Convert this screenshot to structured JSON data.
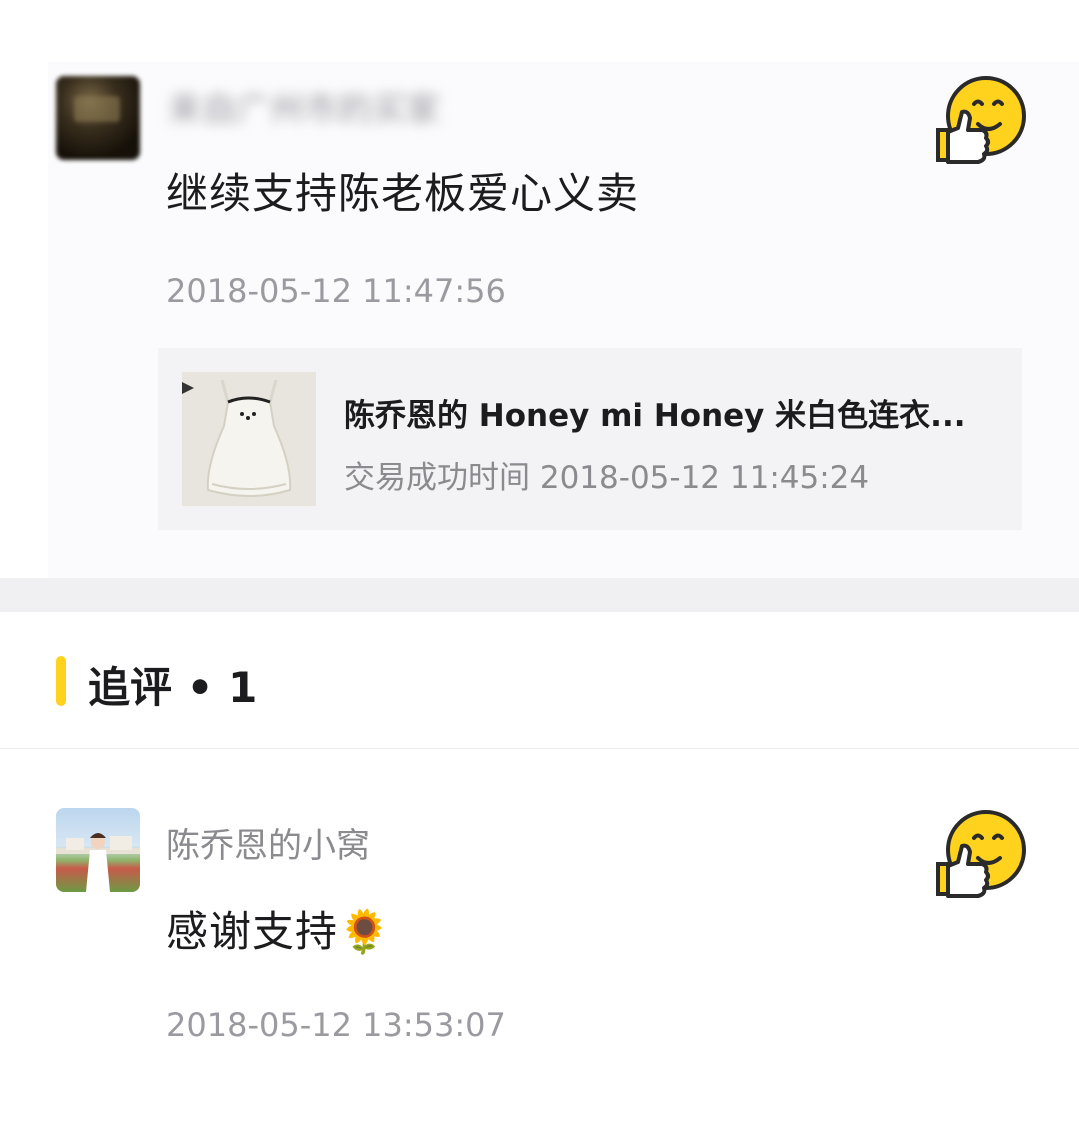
{
  "review": {
    "user_name": "来自广州市的买家",
    "comment": "继续支持陈老板爱心义卖",
    "timestamp": "2018-05-12 11:47:56",
    "like_icon": "thumbs-up-smiley-icon",
    "product": {
      "title": "陈乔恩的 Honey mi Honey 米白色连衣...",
      "time_label": "交易成功时间",
      "time_value": "2018-05-12 11:45:24"
    }
  },
  "followup_section": {
    "title": "追评 • 1",
    "accent_color": "#ffd21e"
  },
  "followup": {
    "user_name": "陈乔恩的小窝",
    "comment": "感谢支持",
    "emoji": "🌻",
    "timestamp": "2018-05-12 13:53:07",
    "like_icon": "thumbs-up-smiley-icon"
  }
}
